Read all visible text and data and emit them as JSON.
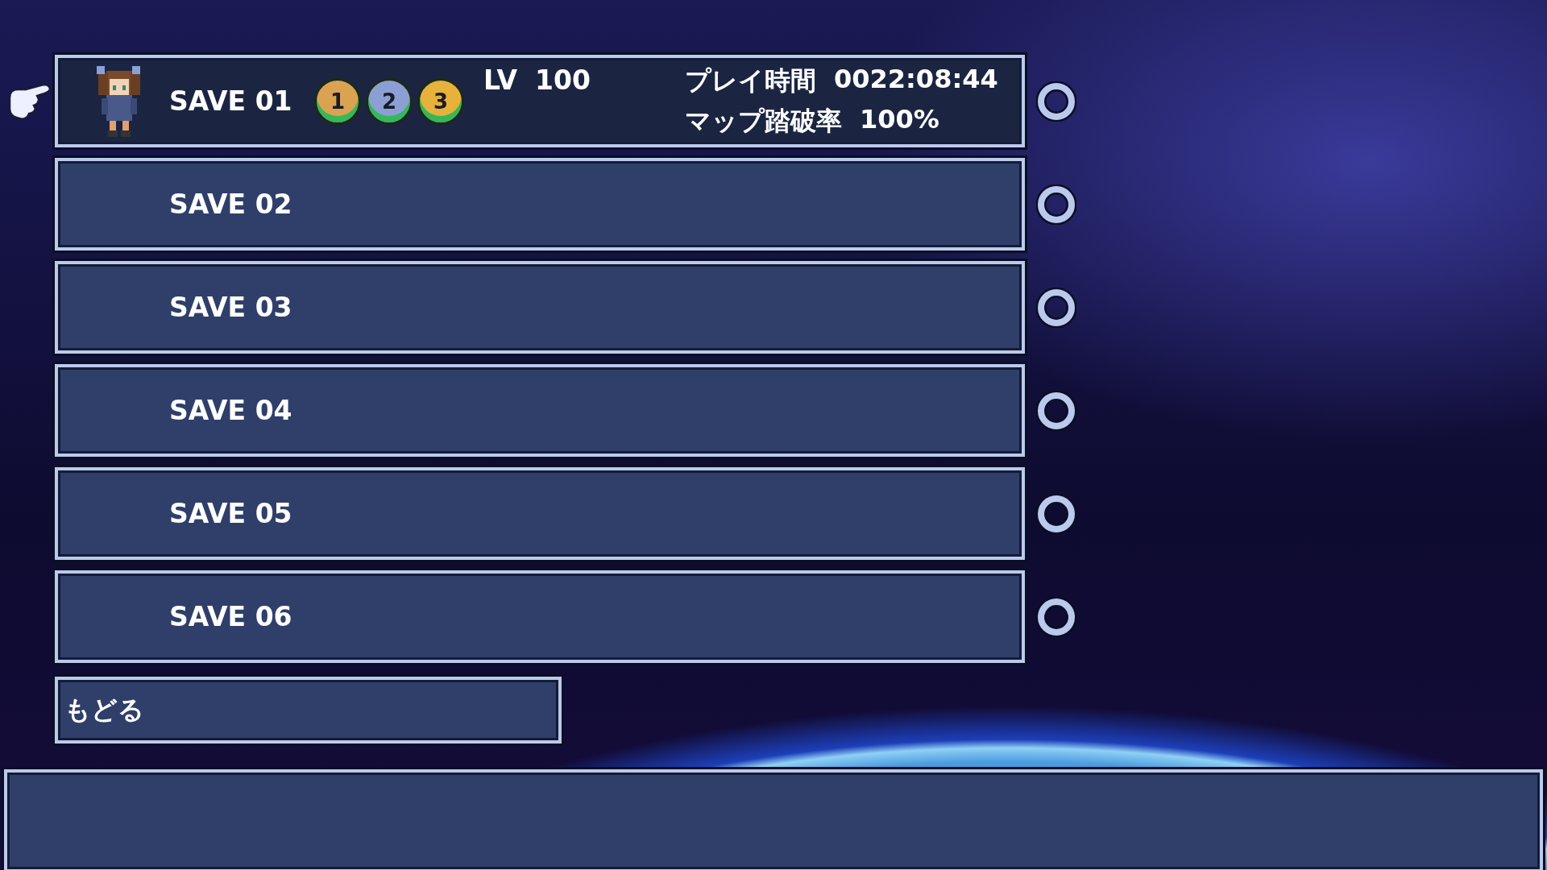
{
  "slots": [
    {
      "kind": "filled",
      "label": "SAVE 01",
      "selected": true,
      "medals": [
        {
          "text": "1",
          "color": "#d9a352"
        },
        {
          "text": "2",
          "color": "#8c9fd4"
        },
        {
          "text": "3",
          "color": "#e6b23c"
        }
      ],
      "level_label": "LV",
      "level_value": "100",
      "playtime_label": "プレイ時間",
      "playtime_value": "0022:08:44",
      "map_label": "マップ踏破率",
      "map_value": "100%"
    },
    {
      "kind": "empty",
      "label": "SAVE 02",
      "selected": false
    },
    {
      "kind": "empty",
      "label": "SAVE 03",
      "selected": false
    },
    {
      "kind": "empty",
      "label": "SAVE 04",
      "selected": false
    },
    {
      "kind": "empty",
      "label": "SAVE 05",
      "selected": false
    },
    {
      "kind": "empty",
      "label": "SAVE 06",
      "selected": false
    }
  ],
  "back_button": {
    "label": "もどる"
  }
}
